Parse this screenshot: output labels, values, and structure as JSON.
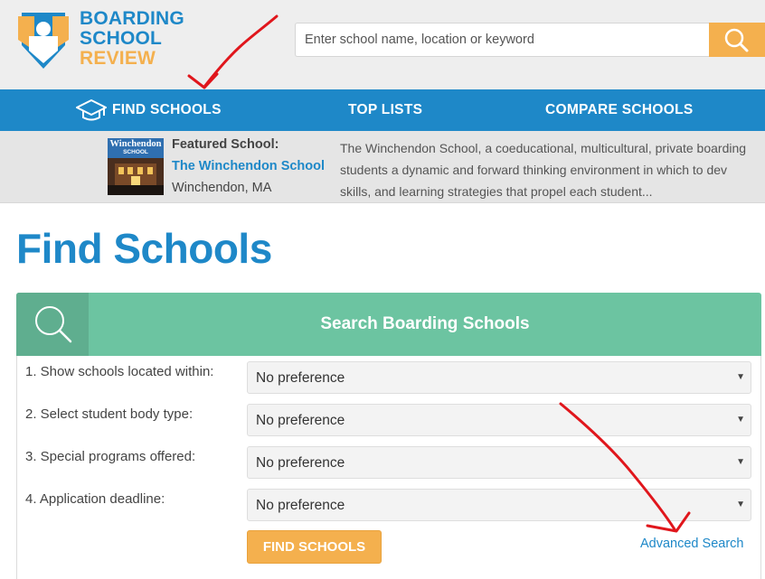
{
  "header": {
    "logo": {
      "line1": "BOARDING",
      "line2": "SCHOOL",
      "line3": "REVIEW"
    },
    "search": {
      "placeholder": "Enter school name, location or keyword",
      "icon": "search-icon"
    }
  },
  "nav": {
    "items": [
      {
        "label": "FIND SCHOOLS",
        "icon": "graduation-cap-icon"
      },
      {
        "label": "TOP LISTS"
      },
      {
        "label": "COMPARE SCHOOLS"
      }
    ]
  },
  "featured": {
    "label": "Featured School:",
    "name": "The Winchendon School",
    "location": "Winchendon, MA",
    "thumb_text": [
      "Winchendon",
      "SCHOOL"
    ],
    "description_lines": [
      "The Winchendon School, a coeducational, multicultural, private boarding",
      "students a dynamic and forward thinking environment in which to dev",
      "skills, and learning strategies that propel each student..."
    ]
  },
  "page": {
    "title": "Find Schools"
  },
  "search_panel": {
    "title": "Search Boarding Schools",
    "rows": [
      {
        "label": "1. Show schools located within:",
        "value": "No preference"
      },
      {
        "label": "2. Select student body type:",
        "value": "No preference"
      },
      {
        "label": "3. Special programs offered:",
        "value": "No preference"
      },
      {
        "label": "4. Application deadline:",
        "value": "No preference"
      }
    ],
    "submit_label": "FIND SCHOOLS",
    "advanced_link": "Advanced Search"
  },
  "colors": {
    "brand_blue": "#1e88c8",
    "brand_orange": "#f4b04e",
    "panel_green": "#6cc4a1",
    "annotation_red": "#e0161c"
  }
}
